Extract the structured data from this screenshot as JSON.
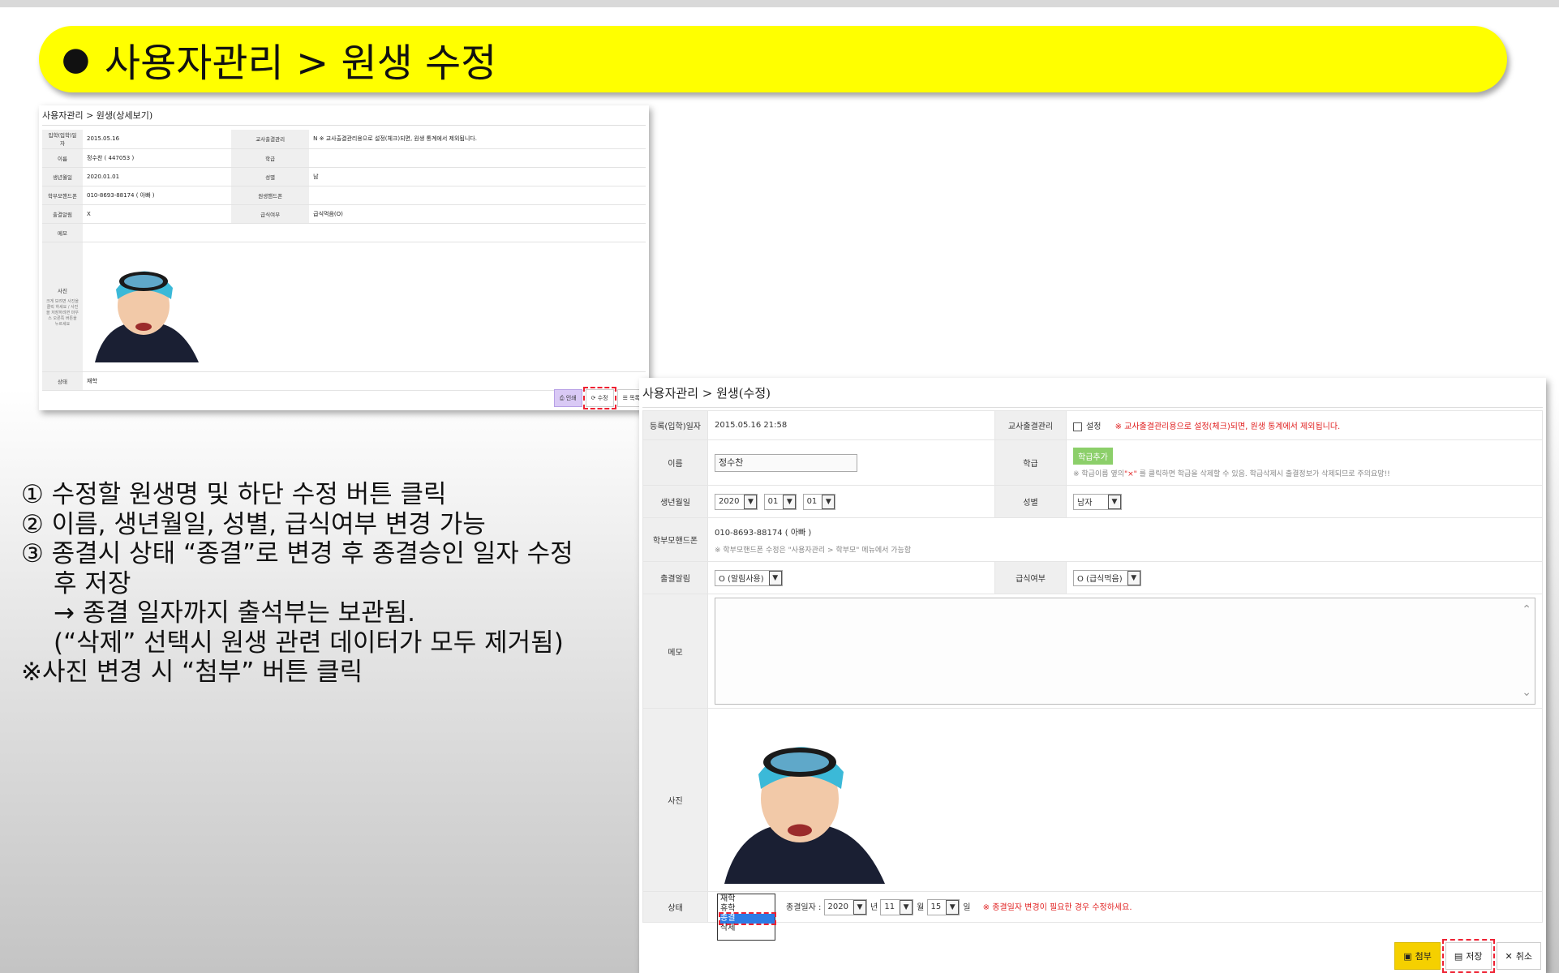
{
  "banner": {
    "bullet": "●",
    "title": "사용자관리 > 원생 수정"
  },
  "instructions": [
    "① 수정할 원생명 및 하단 수정 버튼 클릭",
    "② 이름, 생년월일, 성별, 급식여부 변경 가능",
    "③ 종결시 상태 “종결”로 변경 후 종결승인 일자 수정",
    "후 저장",
    "→ 종결 일자까지 출석부는 보관됨.",
    "(“삭제” 선택시 원생 관련 데이터가 모두 제거됨)",
    "※사진 변경 시 “첨부” 버튼 클릭"
  ],
  "view": {
    "crumb": "사용자관리 > 원생(상세보기)",
    "rows": [
      {
        "l1": "입학(입학)일자",
        "v1": "2015.05.16",
        "l2": "교사출결관리",
        "v2": "N  ※ 교사출결관리용으로 설정(체크)되면, 원생 통계에서 제외됩니다."
      },
      {
        "l1": "이름",
        "v1": "정수찬 ( 447053 )",
        "l2": "학급",
        "v2": ""
      },
      {
        "l1": "생년월일",
        "v1": "2020.01.01",
        "l2": "성별",
        "v2": "남"
      },
      {
        "l1": "학부모핸드폰",
        "v1": "010-8693-88174 ( 아빠 )",
        "l2": "원생핸드폰",
        "v2": ""
      },
      {
        "l1": "출결알림",
        "v1": "X",
        "l2": "급식여부",
        "v2": "급식먹음(O)"
      }
    ],
    "memo_label": "메모",
    "photo_label": "사진",
    "photo_note": "크게 보려면 사진을 클릭 하세요 / 사진을 저장하려면 마우스 오른쪽 버튼을 누르세요",
    "status_label": "상태",
    "status_value": "재학",
    "btn_print": "인쇄",
    "btn_edit": "수정",
    "btn_list": "목록"
  },
  "edit": {
    "crumb": "사용자관리 > 원생(수정)",
    "reg_label": "등록(입학)일자",
    "reg_value": "2015.05.16 21:58",
    "teacher_label": "교사출결관리",
    "teacher_check": "설정",
    "teacher_note": "※ 교사출결관리용으로 설정(체크)되면, 원생 통계에서 제외됩니다.",
    "name_label": "이름",
    "name_value": "정수찬",
    "class_label": "학급",
    "class_btn": "학급추가",
    "class_note_pre": "※ 학급이름 옆의",
    "class_note_x": "\"×\"",
    "class_note_post": "를 클릭하면 학급을 삭제할 수 있음. 학급삭제시 출결정보가 삭제되므로 주의요망!!",
    "birth_label": "생년월일",
    "birth_year": "2020",
    "birth_month": "01",
    "birth_day": "01",
    "gender_label": "성별",
    "gender_value": "남자",
    "parent_label": "학부모핸드폰",
    "parent_value": "010-8693-88174 ( 아빠 )",
    "parent_note": "※ 학부모핸드폰 수정은 \"사용자관리 > 학부모\" 메뉴에서 가능함",
    "alarm_label": "출결알림",
    "alarm_value": "O (알림사용)",
    "meal_label": "급식여부",
    "meal_value": "O (급식먹음)",
    "memo_label": "메모",
    "photo_label": "사진",
    "status_label": "상태",
    "status_options": [
      "재학",
      "휴학",
      "종결",
      "삭제"
    ],
    "end_date_label": "종결일자 :",
    "end_year": "2020",
    "year_unit": "년",
    "end_month": "11",
    "month_unit": "월",
    "end_day": "15",
    "day_unit": "일",
    "end_note": "※ 종결일자 변경이 필요한 경우 수정하세요.",
    "btn_attach": "첨부",
    "btn_save": "저장",
    "btn_cancel": "취소"
  }
}
